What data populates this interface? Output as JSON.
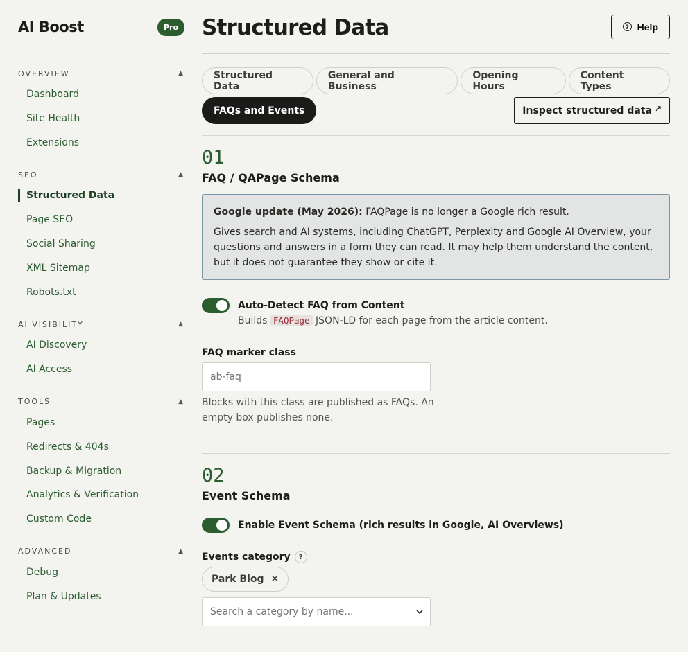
{
  "brand": {
    "title": "AI Boost",
    "badge": "Pro"
  },
  "sidebar": {
    "sections": [
      {
        "head": "OVERVIEW",
        "items": [
          "Dashboard",
          "Site Health",
          "Extensions"
        ]
      },
      {
        "head": "SEO",
        "items": [
          "Structured Data",
          "Page SEO",
          "Social Sharing",
          "XML Sitemap",
          "Robots.txt"
        ],
        "active": "Structured Data"
      },
      {
        "head": "AI VISIBILITY",
        "items": [
          "AI Discovery",
          "AI Access"
        ]
      },
      {
        "head": "TOOLS",
        "items": [
          "Pages",
          "Redirects & 404s",
          "Backup & Migration",
          "Analytics & Verification",
          "Custom Code"
        ]
      },
      {
        "head": "ADVANCED",
        "items": [
          "Debug",
          "Plan & Updates"
        ]
      }
    ]
  },
  "header": {
    "title": "Structured Data",
    "help_label": "Help"
  },
  "tabs": [
    "Structured Data",
    "General and Business",
    "Opening Hours",
    "Content Types",
    "FAQs and Events"
  ],
  "active_tab": "FAQs and Events",
  "inspect_label": "Inspect structured data",
  "faq": {
    "num": "01",
    "title": "FAQ / QAPage Schema",
    "notice_strong": "Google update (May 2026):",
    "notice_rest": " FAQPage is no longer a Google rich result.",
    "notice_body": "Gives search and AI systems, including ChatGPT, Perplexity and Google AI Overview, your questions and answers in a form they can read. It may help them understand the content, but it does not guarantee they show or cite it.",
    "toggle_label": "Auto-Detect FAQ from Content",
    "toggle_desc_pre": "Builds ",
    "toggle_desc_code": "FAQPage",
    "toggle_desc_post": " JSON-LD for each page from the article content.",
    "marker_label": "FAQ marker class",
    "marker_placeholder": "ab-faq",
    "marker_help": "Blocks with this class are published as FAQs. An empty box publishes none."
  },
  "event": {
    "num": "02",
    "title": "Event Schema",
    "toggle_label": "Enable Event Schema (rich results in Google, AI Overviews)",
    "category_label": "Events category",
    "help_mark": "?",
    "chip_label": "Park Blog",
    "search_placeholder": "Search a category by name..."
  }
}
